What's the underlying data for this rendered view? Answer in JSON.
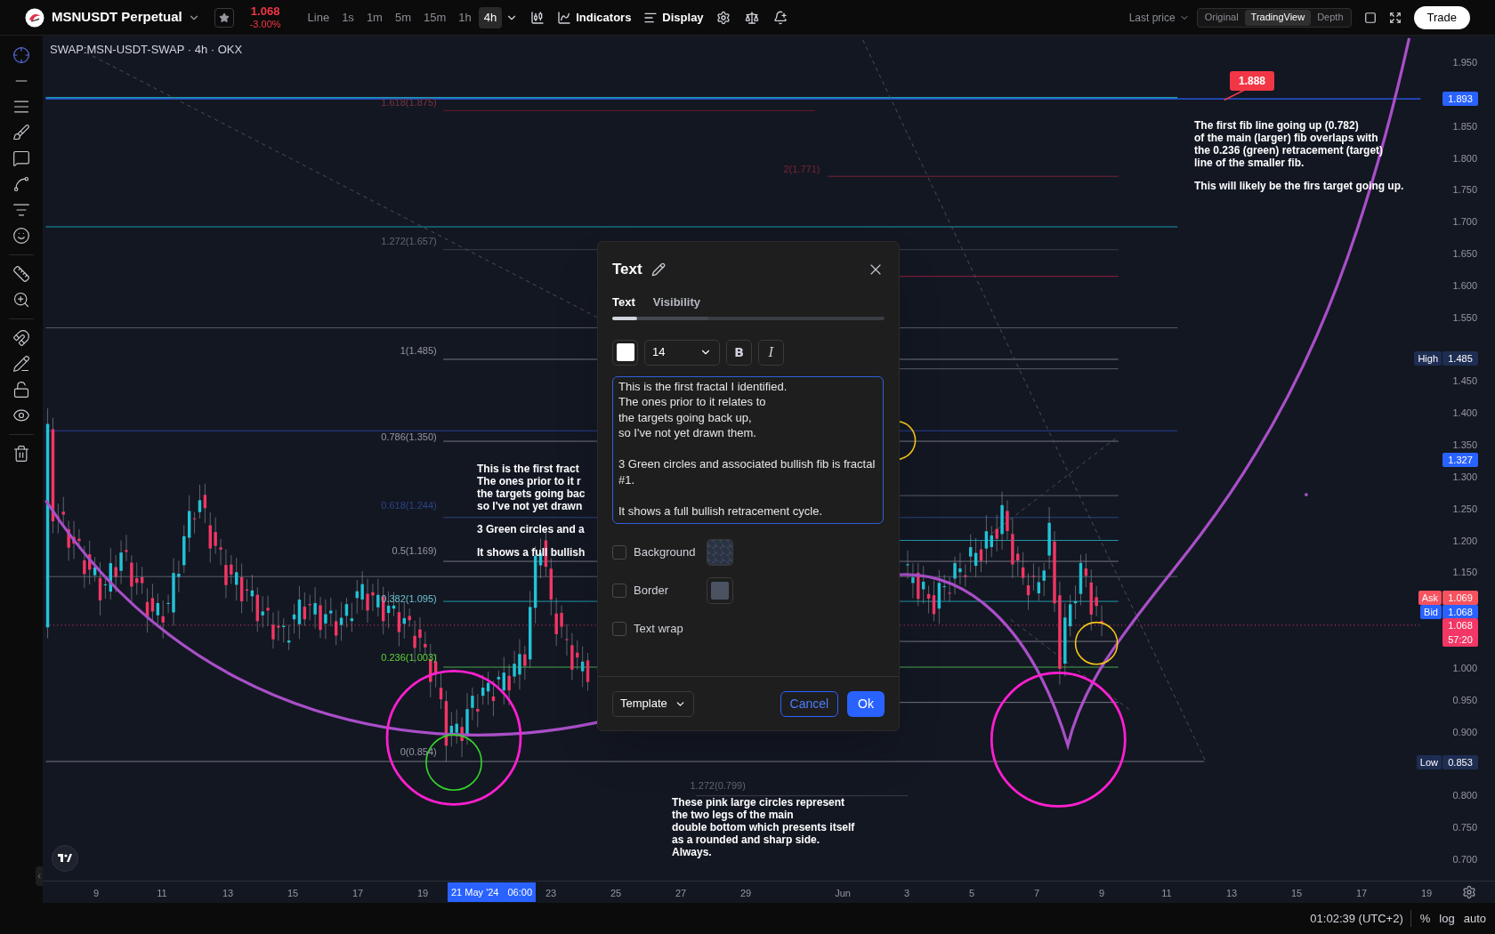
{
  "top_bar": {
    "symbol": "MSNUSDT Perpetual",
    "price": "1.068",
    "change": "-3.00%",
    "intervals": [
      {
        "label": "Line",
        "selected": false
      },
      {
        "label": "1s",
        "selected": false
      },
      {
        "label": "1m",
        "selected": false
      },
      {
        "label": "5m",
        "selected": false
      },
      {
        "label": "15m",
        "selected": false
      },
      {
        "label": "1h",
        "selected": false
      },
      {
        "label": "4h",
        "selected": true
      }
    ],
    "tools": [
      "Indicators",
      "Display"
    ],
    "price_source": "Last price",
    "views": [
      {
        "label": "Original",
        "selected": false
      },
      {
        "label": "TradingView",
        "selected": true
      },
      {
        "label": "Depth",
        "selected": false
      }
    ],
    "trade_button": "Trade"
  },
  "chart": {
    "title": "SWAP:MSN-USDT-SWAP · 4h · OKX",
    "fib_labels": [
      {
        "text": "1.618(1.875)",
        "color": "#7a3444"
      },
      {
        "text": "2(1.771)",
        "color": "#7a2434"
      },
      {
        "text": "1.272(1.657)",
        "color": "#62666f"
      },
      {
        "text": "1(1.485)",
        "color": "#9598a1"
      },
      {
        "text": "0.786(1.350)",
        "color": "#9598a1"
      },
      {
        "text": "0.618(1.244)",
        "color": "#2b4586"
      },
      {
        "text": "0.5(1.169)",
        "color": "#9598a1"
      },
      {
        "text": "0.382(1.095)",
        "color": "#6cc3d0"
      },
      {
        "text": "0.236(1.003)",
        "color": "#5fd33a"
      },
      {
        "text": "0(0.854)",
        "color": "#9598a1"
      },
      {
        "text": "1.272(0.799)",
        "color": "#62666f"
      }
    ],
    "callout": "1.888",
    "annotations": [
      {
        "paragraphs": [
          [
            "This is the first fract",
            "The ones prior to it r",
            "the targets going bac",
            "so I've not yet drawn"
          ],
          [
            "3 Green circles and a"
          ],
          [
            "It shows a full bullish"
          ]
        ]
      },
      {
        "paragraphs": [
          [
            "These pink large circles represent",
            "the two legs of the main",
            "double bottom which presents itself",
            "as a rounded and sharp side.",
            "Always."
          ]
        ]
      },
      {
        "paragraphs": [
          [
            "The first fib line going up (0.782)",
            "of the main (larger) fib overlaps with",
            "the 0.236 (green) retracement (target)",
            "line of the smaller fib."
          ],
          [
            "This will likely be the firs target going up."
          ]
        ]
      }
    ]
  },
  "price_axis": {
    "labels": [
      "1.950",
      "1.850",
      "1.800",
      "1.750",
      "1.700",
      "1.650",
      "1.600",
      "1.550",
      "1.450",
      "1.400",
      "1.350",
      "1.300",
      "1.250",
      "1.200",
      "1.150",
      "1.000",
      "0.950",
      "0.900",
      "0.800",
      "0.750",
      "0.700"
    ],
    "badges": [
      {
        "value": "1.893",
        "color": "#2962ff"
      },
      {
        "label": "High",
        "value": "1.485",
        "color": "#1e2d52"
      },
      {
        "value": "1.327",
        "color": "#2962ff"
      },
      {
        "label": "Ask",
        "value": "1.069",
        "color": "#f7525f"
      },
      {
        "label": "Bid",
        "value": "1.068",
        "color": "#2962ff"
      },
      {
        "value": "1.068",
        "countdown": "57:20",
        "color": "#f23665"
      },
      {
        "label": "Low",
        "value": "0.853",
        "color": "#1e2d52"
      }
    ]
  },
  "time_axis": {
    "labels": [
      "9",
      "11",
      "13",
      "15",
      "17",
      "19",
      "23",
      "25",
      "27",
      "29",
      "Jun",
      "3",
      "5",
      "7",
      "9",
      "11",
      "13",
      "15",
      "17",
      "19"
    ],
    "cursor_date": "21 May '24",
    "cursor_time": "06:00"
  },
  "dialog": {
    "title": "Text",
    "tabs": [
      {
        "label": "Text",
        "selected": true
      },
      {
        "label": "Visibility",
        "selected": false
      }
    ],
    "color_swatch": {
      "color": "#ffffff"
    },
    "font_size": "14",
    "format_buttons": [
      {
        "kind": "bold",
        "label": "B"
      },
      {
        "kind": "italic",
        "label": "I"
      }
    ],
    "text": "This is the first fractal I identified.\nThe ones prior to it relates to\nthe targets going back up,\nso I've not yet drawn them.\n\n3 Green circles and associated bullish fib is fractal #1.\n\nIt shows a full bullish retracement cycle.",
    "options": [
      {
        "label": "Background",
        "checked": false,
        "kind": "fill"
      },
      {
        "label": "Border",
        "checked": false,
        "kind": "border"
      },
      {
        "label": "Text wrap",
        "checked": false,
        "kind": "plain"
      }
    ],
    "template": "Template",
    "cancel": "Cancel",
    "ok": "Ok"
  },
  "status_bar": {
    "time": "01:02:39 (UTC+2)",
    "options": [
      "%",
      "log",
      "auto"
    ]
  }
}
